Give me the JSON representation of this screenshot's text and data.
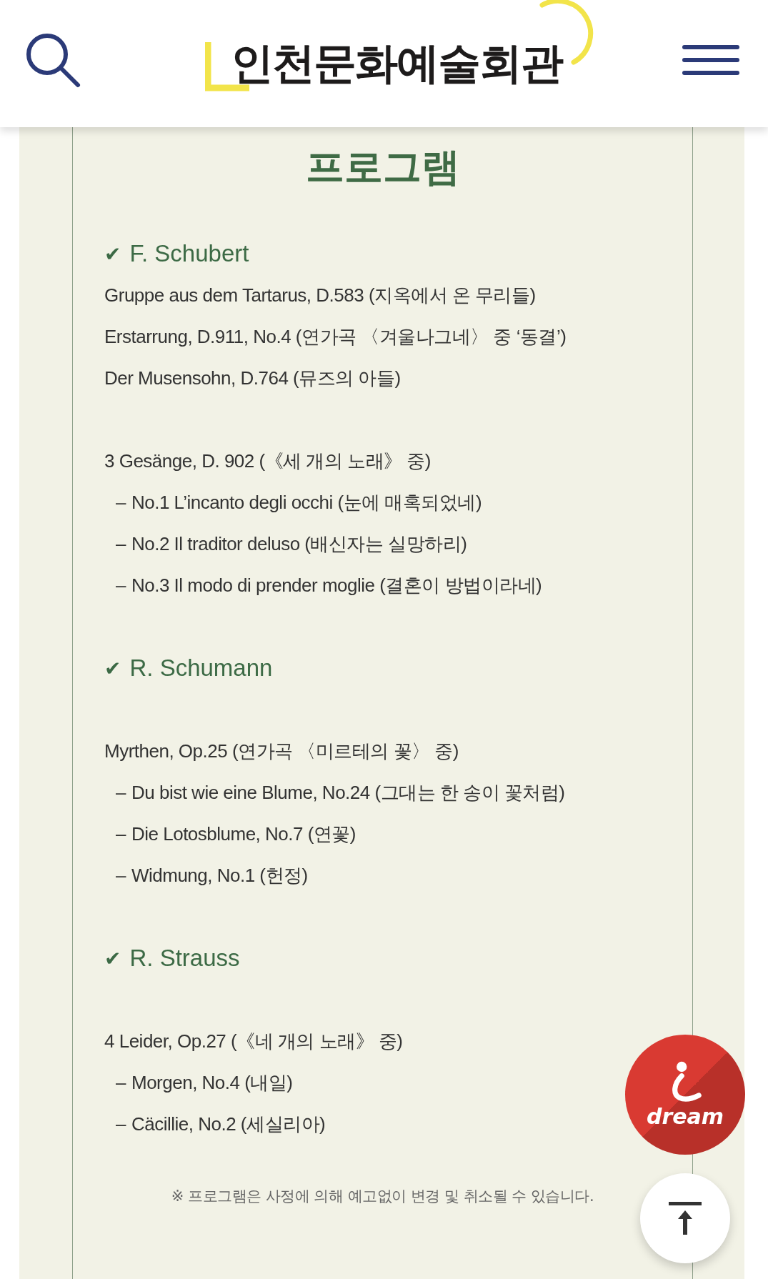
{
  "header": {
    "logo": "인천문화예술회관"
  },
  "program": {
    "title": "프로그램",
    "sections": [
      {
        "check": "✔",
        "composer": "F. Schubert",
        "groups": [
          {
            "lines": [
              {
                "kind": "work",
                "text": "Gruppe aus dem Tartarus, D.583 (지옥에서 온 무리들)"
              },
              {
                "kind": "work",
                "text": "Erstarrung, D.911, No.4 (연가곡 〈겨울나그네〉 중 ‘동결’)"
              },
              {
                "kind": "work",
                "text": "Der Musensohn, D.764 (뮤즈의 아들)"
              }
            ]
          },
          {
            "lines": [
              {
                "kind": "work",
                "text": "3 Gesänge, D. 902 (《세 개의 노래》 중)"
              },
              {
                "kind": "movement",
                "dash": "–",
                "text": "No.1 L’incanto degli occhi (눈에 매혹되었네)"
              },
              {
                "kind": "movement",
                "dash": "–",
                "text": "No.2 Il traditor deluso (배신자는 실망하리)"
              },
              {
                "kind": "movement",
                "dash": "–",
                "text": "No.3 Il modo di prender moglie (결혼이 방법이라네)"
              }
            ]
          }
        ]
      },
      {
        "check": "✔",
        "composer": "R. Schumann",
        "groups": [
          {
            "lines": [
              {
                "kind": "work",
                "text": "Myrthen, Op.25 (연가곡 〈미르테의 꽃〉 중)"
              },
              {
                "kind": "movement",
                "dash": "–",
                "text": "Du bist wie eine Blume, No.24 (그대는 한 송이 꽃처럼)"
              },
              {
                "kind": "movement",
                "dash": "–",
                "text": "Die Lotosblume, No.7 (연꽃)"
              },
              {
                "kind": "movement",
                "dash": "–",
                "text": "Widmung, No.1 (헌정)"
              }
            ]
          }
        ]
      },
      {
        "check": "✔",
        "composer": "R. Strauss",
        "groups": [
          {
            "lines": [
              {
                "kind": "work",
                "text": "4 Leider, Op.27 (《네 개의 노래》 중)"
              },
              {
                "kind": "movement",
                "dash": "–",
                "text": "Morgen, No.4 (내일)"
              },
              {
                "kind": "movement",
                "dash": "–",
                "text": "Cäcillie, No.2 (세실리아)"
              }
            ]
          }
        ]
      }
    ],
    "note": "※ 프로그램은 사정에 의해 예고없이 변경 및 취소될 수 있습니다."
  },
  "dream_button": {
    "label": "dream"
  }
}
